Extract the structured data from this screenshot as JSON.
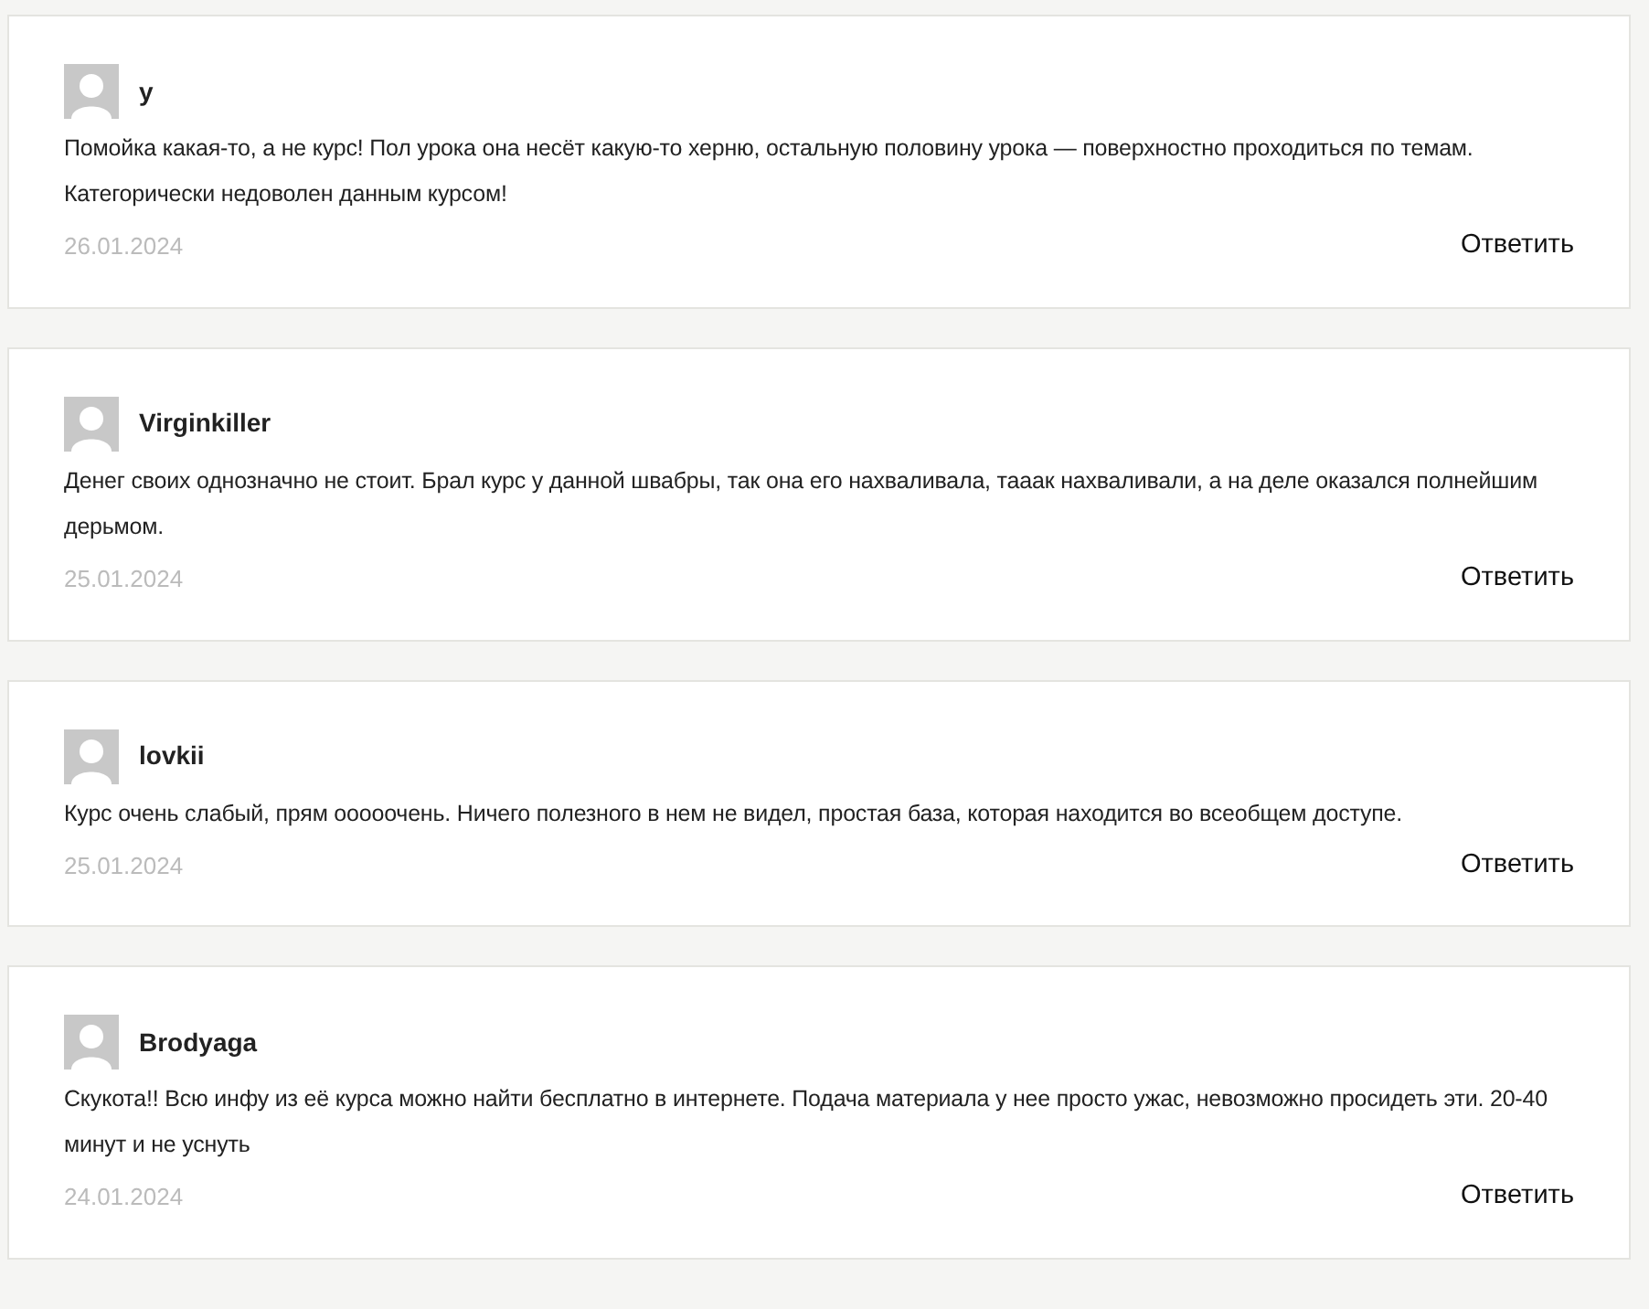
{
  "comments": [
    {
      "author": "у",
      "text": "Помойка какая-то, а не курс! Пол урока она несёт какую-то херню, остальную половину урока — поверхностно проходиться по темам. Категорически недоволен данным курсом!",
      "date": "26.01.2024",
      "reply": "Ответить"
    },
    {
      "author": "Virginkiller",
      "text": "Денег своих однозначно не стоит. Брал курс у данной швабры, так она его нахваливала, тааак нахваливали, а на деле оказался полнейшим дерьмом.",
      "date": "25.01.2024",
      "reply": "Ответить"
    },
    {
      "author": "lovkii",
      "text": "Курс очень слабый, прям ооооочень. Ничего полезного в нем не видел, простая база, которая находится во всеобщем доступе.",
      "date": "25.01.2024",
      "reply": "Ответить"
    },
    {
      "author": "Brodyaga",
      "text": "Скукота!! Всю инфу из её курса можно найти бесплатно в интернете. Подача материала у нее просто ужас, невозможно просидеть эти. 20-40 минут и не уснуть",
      "date": "24.01.2024",
      "reply": "Ответить"
    }
  ]
}
